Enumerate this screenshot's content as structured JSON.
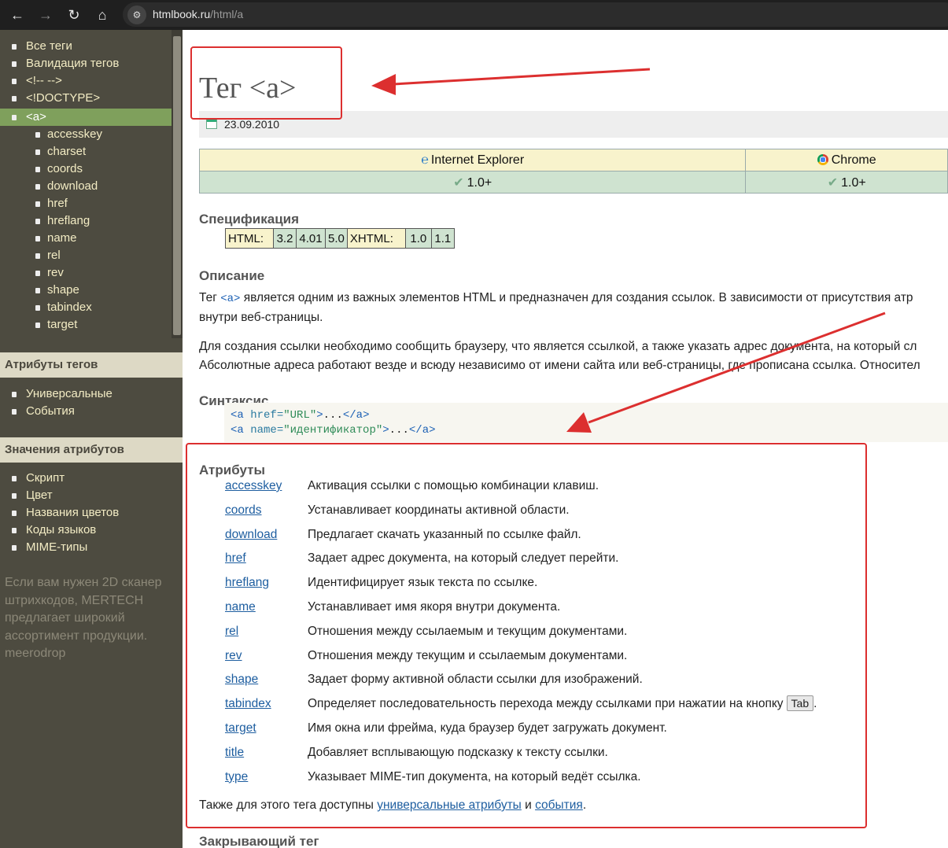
{
  "browser": {
    "url_host": "htmlbook.ru",
    "url_path": "/html/a"
  },
  "sidebar": {
    "tree_top": [
      {
        "label": "Все теги"
      },
      {
        "label": "Валидация тегов"
      },
      {
        "label": "<!-- -->"
      },
      {
        "label": "<!DOCTYPE>"
      },
      {
        "label": "<a>",
        "active": true
      }
    ],
    "tree_sub": [
      "accesskey",
      "charset",
      "coords",
      "download",
      "href",
      "hreflang",
      "name",
      "rel",
      "rev",
      "shape",
      "tabindex",
      "target"
    ],
    "section_attrs": {
      "header": "Атрибуты тегов",
      "items": [
        "Универсальные",
        "События"
      ]
    },
    "section_values": {
      "header": "Значения атрибутов",
      "items": [
        "Скрипт",
        "Цвет",
        "Названия цветов",
        "Коды языков",
        "MIME-типы"
      ]
    },
    "promo": "Если вам нужен 2D сканер штрихкодов, MERTECH предлагает широкий ассортимент продукции. meerodrop"
  },
  "page": {
    "title": "Тег <a>",
    "date": "23.09.2010",
    "browsers": [
      {
        "name": "Internet Explorer",
        "version": "1.0+"
      },
      {
        "name": "Chrome",
        "version": "1.0+"
      }
    ],
    "spec": {
      "heading": "Спецификация",
      "html_label": "HTML:",
      "html_versions": [
        "3.2",
        "4.01",
        "5.0"
      ],
      "xhtml_label": "XHTML:",
      "xhtml_versions": [
        "1.0",
        "1.1"
      ]
    },
    "description": {
      "heading": "Описание",
      "p1_before": "Тег ",
      "p1_tag": "<a>",
      "p1_after": " является одним из важных элементов HTML и предназначен для создания ссылок. В зависимости от присутствия атр",
      "p1_line2": "внутри веб-страницы.",
      "p2_line1": "Для создания ссылки необходимо сообщить браузеру, что является ссылкой, а также указать адрес документа, на который сл",
      "p2_line2": "Абсолютные адреса работают везде и всюду независимо от имени сайта или веб-страницы, где прописана ссылка. Относител"
    },
    "syntax": {
      "heading": "Синтаксис",
      "line1": {
        "open": "<a ",
        "attr": "href=",
        "val": "\"URL\"",
        "close": ">",
        "dots": "...",
        "end": "</a>"
      },
      "line2": {
        "open": "<a ",
        "attr": "name=",
        "val": "\"идентификатор\"",
        "close": ">",
        "dots": "...",
        "end": "</a>"
      }
    },
    "attributes": {
      "heading": "Атрибуты",
      "rows": [
        {
          "name": "accesskey",
          "desc": "Активация ссылки с помощью комбинации клавиш."
        },
        {
          "name": "coords",
          "desc": "Устанавливает координаты активной области."
        },
        {
          "name": "download",
          "desc": "Предлагает скачать указанный по ссылке файл."
        },
        {
          "name": "href",
          "desc": "Задает адрес документа, на который следует перейти."
        },
        {
          "name": "hreflang",
          "desc": "Идентифицирует язык текста по ссылке."
        },
        {
          "name": "name",
          "desc": "Устанавливает имя якоря внутри документа."
        },
        {
          "name": "rel",
          "desc": "Отношения между ссылаемым и текущим документами."
        },
        {
          "name": "rev",
          "desc": "Отношения между текущим и ссылаемым документами."
        },
        {
          "name": "shape",
          "desc": "Задает форму активной области ссылки для изображений."
        },
        {
          "name": "tabindex",
          "desc": "Определяет последовательность перехода между ссылками при нажатии на кнопку",
          "kbd": "Tab",
          "tail": "."
        },
        {
          "name": "target",
          "desc": "Имя окна или фрейма, куда браузер будет загружать документ."
        },
        {
          "name": "title",
          "desc": "Добавляет всплывающую подсказку к тексту ссылки."
        },
        {
          "name": "type",
          "desc": "Указывает MIME-тип документа, на который ведёт ссылка."
        }
      ],
      "also_before": "Также для этого тега доступны ",
      "also_link1": "универсальные атрибуты",
      "also_mid": " и ",
      "also_link2": "события",
      "also_after": "."
    },
    "closing": {
      "heading": "Закрывающий тег"
    }
  },
  "annotation": {
    "color": "#dc2f2f"
  }
}
